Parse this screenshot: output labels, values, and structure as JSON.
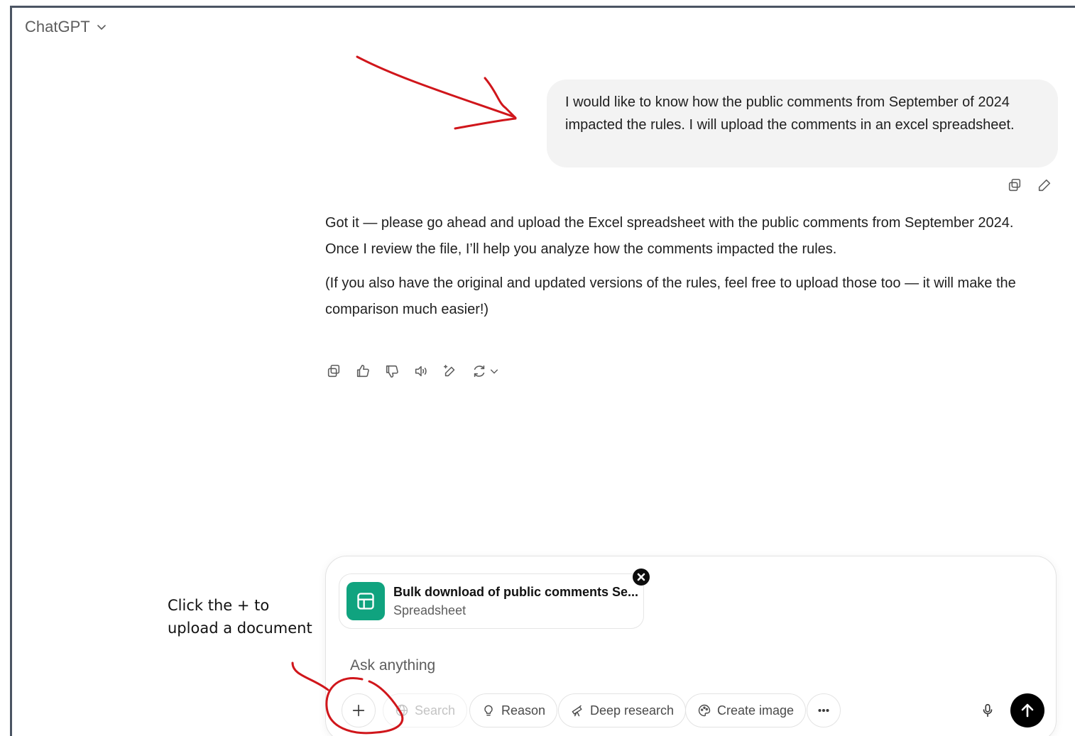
{
  "header": {
    "model_name": "ChatGPT"
  },
  "conversation": {
    "user_message": "I would like to know how the public comments from September of 2024 impacted the rules. I will upload the comments in an excel spreadsheet.",
    "assistant_paragraphs": [
      "Got it — please go ahead and upload the Excel spreadsheet with the public comments from September 2024.",
      "Once I review the file, I’ll help you analyze how the comments impacted the rules.",
      "(If you also have the original and updated versions of the rules, feel free to upload those too — it will make the comparison much easier!)"
    ]
  },
  "composer": {
    "attachment": {
      "name": "Bulk download of public comments Se...",
      "type": "Spreadsheet",
      "icon": "spreadsheet-icon",
      "icon_color": "#10a37f"
    },
    "placeholder": "Ask anything",
    "tools": {
      "search": "Search",
      "reason": "Reason",
      "deep_research": "Deep research",
      "create_image": "Create image"
    }
  },
  "annotation": {
    "line1": "Click the + to",
    "line2": "upload a document",
    "color": "#d0161b"
  }
}
